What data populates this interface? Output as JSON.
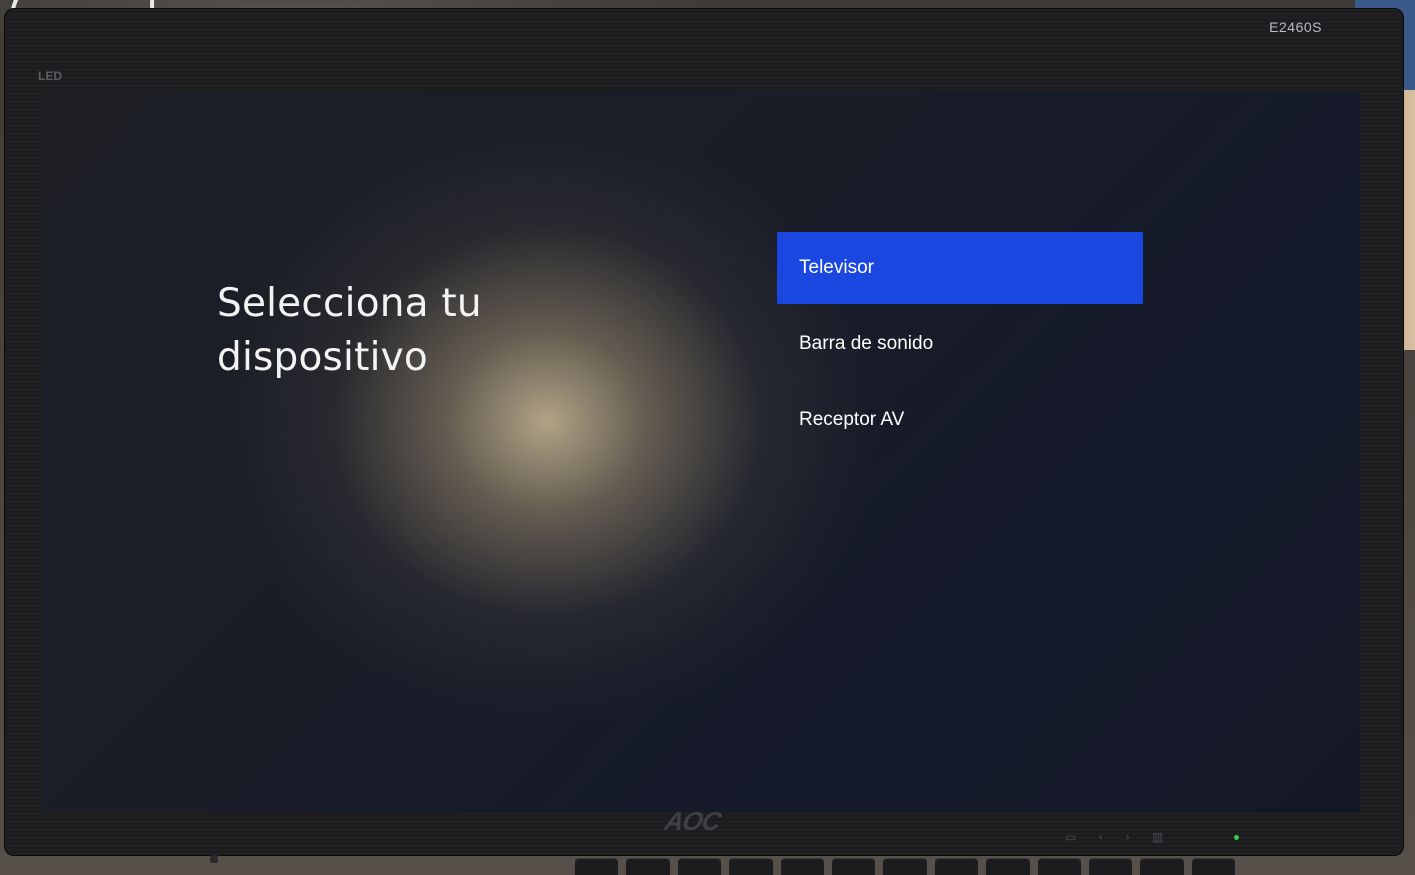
{
  "monitor": {
    "led_label": "LED",
    "model": "E2460S",
    "brand": "AOC"
  },
  "setup": {
    "title": "Selecciona tu dispositivo",
    "options": [
      {
        "label": "Televisor",
        "selected": true
      },
      {
        "label": "Barra de sonido",
        "selected": false
      },
      {
        "label": "Receptor AV",
        "selected": false
      }
    ]
  },
  "colors": {
    "selection_highlight": "#1a47e0",
    "text": "#ffffff"
  }
}
